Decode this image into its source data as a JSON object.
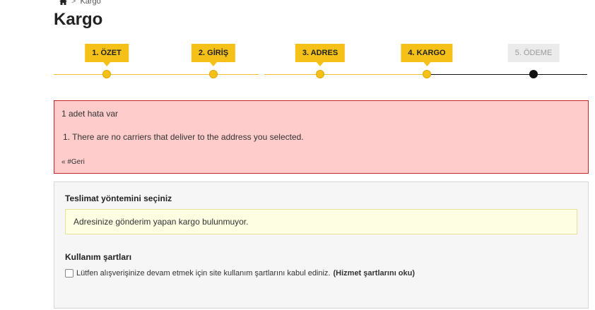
{
  "breadcrumb": {
    "separator": ">",
    "current": "Kargo"
  },
  "page_title": "Kargo",
  "steps": [
    {
      "label": "1. ÖZET",
      "state": "done"
    },
    {
      "label": "2. GİRİŞ",
      "state": "done"
    },
    {
      "label": "3. ADRES",
      "state": "done"
    },
    {
      "label": "4. KARGO",
      "state": "done"
    },
    {
      "label": "5. ÖDEME",
      "state": "todo"
    }
  ],
  "error": {
    "title": "1 adet hata var",
    "items": [
      "1.  There are no carriers that deliver to the address you selected."
    ],
    "back_link": "« #Geri"
  },
  "delivery": {
    "title": "Teslimat yöntemini seçiniz",
    "warning": "Adresinize gönderim yapan kargo bulunmuyor."
  },
  "terms": {
    "title": "Kullanım şartları",
    "checkbox_label": "Lütfen alışverişinize devam etmek için site kullanım şartlarını kabul ediniz.",
    "link_label": "(Hizmet şartlarını oku)",
    "checked": false
  },
  "colors": {
    "accent": "#f5c118",
    "error_bg": "#ffcccc",
    "error_border": "#c0262b",
    "warning_bg": "#fefee3"
  }
}
